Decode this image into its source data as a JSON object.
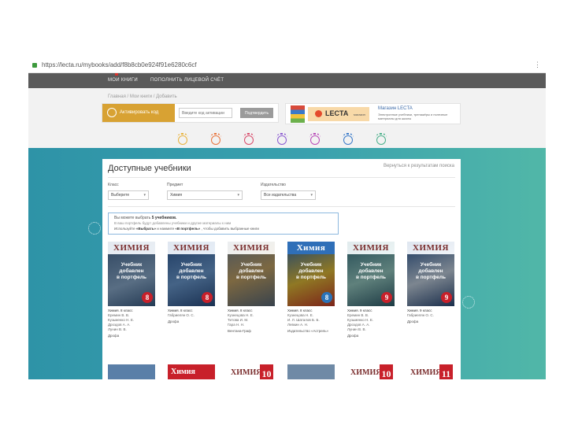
{
  "browser": {
    "url": "https://lecta.ru/mybooks/add/f8b8cb0e924f91e6280c6cf"
  },
  "site_nav": {
    "items": [
      "МОИ КНИГИ",
      "ПОПОЛНИТЬ ЛИЦЕВОЙ СЧЁТ"
    ]
  },
  "breadcrumb": "Главная / Мои книги / Добавить",
  "activation": {
    "label": "Активировать код",
    "placeholder": "Введите код активации",
    "button": "Подтвердить"
  },
  "ad": {
    "logo": "LECTA",
    "logo_sub": "магазин",
    "title": "Магазин LECTA",
    "desc": "Электронные учебники, тренажёры и полезные материалы для школы"
  },
  "colors": {
    "teal_start": "#2e93a7",
    "teal_end": "#51b7a8",
    "gold": "#d8a233",
    "nav": "#5a5a5a",
    "notice_border": "#8cb8de"
  },
  "catalog": {
    "title": "Доступные учебники",
    "link_right": "Вернуться к результатам поиска",
    "filters": [
      {
        "label": "Класс",
        "value": "Выберите"
      },
      {
        "label": "Предмет",
        "value": "Химия"
      },
      {
        "label": "Издательство",
        "value": "Все издательства"
      }
    ],
    "notice": {
      "line1_prefix": "Вы можете выбрать",
      "line1_bold": "5 учебников.",
      "line2": "В ваш портфель будут добавлены учебники и другие материалы к ним",
      "line3_prefix": "Используйте",
      "line3_bold1": "«Выбрать»",
      "line3_mid": "и нажмите",
      "line3_bold2": "«В портфель»",
      "line3_suffix": ", чтобы добавить выбранные книги"
    },
    "books": [
      {
        "title": "Химия. 8 класс",
        "authors": "Еремин В. В.\nКузьменко Н. Е.\nДроздов А. А.\nЛунин В. В.",
        "publisher": "Дрофа",
        "cover_title": "ХИМИЯ",
        "overlay": "Учебник\nдобавлен\nв портфель",
        "grade": "8",
        "grade_color": "#c8202a"
      },
      {
        "title": "Химия. 8 класс",
        "authors": "Габриелян О. С.",
        "publisher": "Дрофа",
        "cover_title": "ХИМИЯ",
        "overlay": "Учебник\nдобавлен\nв портфель",
        "grade": "8",
        "grade_color": "#c8202a"
      },
      {
        "title": "Химия. 8 класс",
        "authors": "Кузнецова Н. Е.\nТитова И. М.\nГара Н. Н.",
        "publisher": "Вентана-Граф",
        "cover_title": "ХИМИЯ",
        "overlay": "Учебник\nдобавлен\nв портфель",
        "grade": "",
        "grade_color": "#2a73b8"
      },
      {
        "title": "Химия. 8 класс",
        "authors": "Кузнецова Н. Е.\nИ. Л. Шаталов Б. Б.\nЛевкин А. Н.",
        "publisher": "Издательство «Астрель»",
        "cover_title": "Химия",
        "overlay": "Учебник\nдобавлен\nв портфель",
        "grade": "8",
        "grade_color": "#2a73b8"
      },
      {
        "title": "Химия. 9 класс",
        "authors": "Еремин В. В.\nКузьменко Н. Е.\nДроздов А. А.\nЛунин В. В.",
        "publisher": "Дрофа",
        "cover_title": "ХИМИЯ",
        "overlay": "Учебник\nдобавлен\nв портфель",
        "grade": "9",
        "grade_color": "#c8202a"
      },
      {
        "title": "Химия. 9 класс",
        "authors": "Габриелян О. С.",
        "publisher": "Дрофа",
        "cover_title": "ХИМИЯ",
        "overlay": "Учебник\nдобавлен\nв портфель",
        "grade": "9",
        "grade_color": "#c8202a"
      }
    ],
    "next_row": [
      {
        "head": "",
        "num": ""
      },
      {
        "head": "Химия",
        "num": ""
      },
      {
        "head": "ХИМИЯ",
        "num": "10"
      },
      {
        "head": "",
        "num": ""
      },
      {
        "head": "ХИМИЯ",
        "num": "10"
      },
      {
        "head": "ХИМИЯ",
        "num": "11"
      }
    ]
  }
}
